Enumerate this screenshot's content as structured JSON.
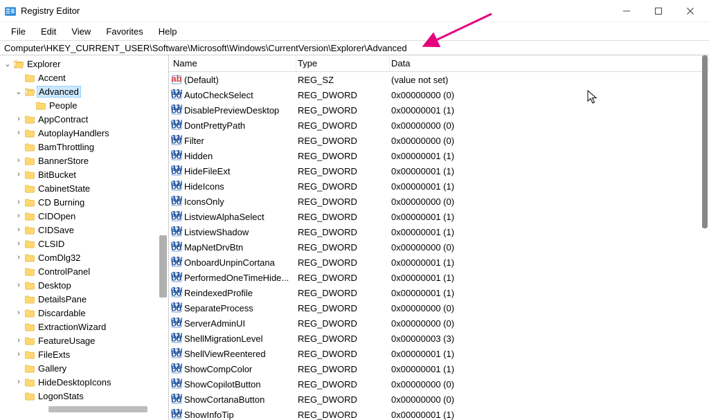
{
  "window": {
    "title": "Registry Editor"
  },
  "menubar": {
    "file": "File",
    "edit": "Edit",
    "view": "View",
    "favorites": "Favorites",
    "help": "Help"
  },
  "address": {
    "path": "Computer\\HKEY_CURRENT_USER\\Software\\Microsoft\\Windows\\CurrentVersion\\Explorer\\Advanced"
  },
  "columns": {
    "name": "Name",
    "type": "Type",
    "data": "Data"
  },
  "tree": {
    "root": {
      "label": "Explorer",
      "expanded": true,
      "depth": 0
    },
    "children": [
      {
        "label": "Accent",
        "depth": 1,
        "hasChildren": false
      },
      {
        "label": "Advanced",
        "depth": 1,
        "hasChildren": true,
        "expanded": true,
        "selected": true
      },
      {
        "label": "People",
        "depth": 2,
        "hasChildren": false
      },
      {
        "label": "AppContract",
        "depth": 1,
        "hasChildren": true
      },
      {
        "label": "AutoplayHandlers",
        "depth": 1,
        "hasChildren": true
      },
      {
        "label": "BamThrottling",
        "depth": 1,
        "hasChildren": false
      },
      {
        "label": "BannerStore",
        "depth": 1,
        "hasChildren": true
      },
      {
        "label": "BitBucket",
        "depth": 1,
        "hasChildren": true
      },
      {
        "label": "CabinetState",
        "depth": 1,
        "hasChildren": false
      },
      {
        "label": "CD Burning",
        "depth": 1,
        "hasChildren": true
      },
      {
        "label": "CIDOpen",
        "depth": 1,
        "hasChildren": true
      },
      {
        "label": "CIDSave",
        "depth": 1,
        "hasChildren": true
      },
      {
        "label": "CLSID",
        "depth": 1,
        "hasChildren": true
      },
      {
        "label": "ComDlg32",
        "depth": 1,
        "hasChildren": true
      },
      {
        "label": "ControlPanel",
        "depth": 1,
        "hasChildren": false
      },
      {
        "label": "Desktop",
        "depth": 1,
        "hasChildren": true
      },
      {
        "label": "DetailsPane",
        "depth": 1,
        "hasChildren": false
      },
      {
        "label": "Discardable",
        "depth": 1,
        "hasChildren": true
      },
      {
        "label": "ExtractionWizard",
        "depth": 1,
        "hasChildren": false
      },
      {
        "label": "FeatureUsage",
        "depth": 1,
        "hasChildren": true
      },
      {
        "label": "FileExts",
        "depth": 1,
        "hasChildren": true
      },
      {
        "label": "Gallery",
        "depth": 1,
        "hasChildren": false
      },
      {
        "label": "HideDesktopIcons",
        "depth": 1,
        "hasChildren": true
      },
      {
        "label": "LogonStats",
        "depth": 1,
        "hasChildren": false
      }
    ]
  },
  "values": [
    {
      "name": "(Default)",
      "type": "REG_SZ",
      "data": "(value not set)",
      "iconType": "sz"
    },
    {
      "name": "AutoCheckSelect",
      "type": "REG_DWORD",
      "data": "0x00000000 (0)",
      "iconType": "dw"
    },
    {
      "name": "DisablePreviewDesktop",
      "type": "REG_DWORD",
      "data": "0x00000001 (1)",
      "iconType": "dw"
    },
    {
      "name": "DontPrettyPath",
      "type": "REG_DWORD",
      "data": "0x00000000 (0)",
      "iconType": "dw"
    },
    {
      "name": "Filter",
      "type": "REG_DWORD",
      "data": "0x00000000 (0)",
      "iconType": "dw"
    },
    {
      "name": "Hidden",
      "type": "REG_DWORD",
      "data": "0x00000001 (1)",
      "iconType": "dw"
    },
    {
      "name": "HideFileExt",
      "type": "REG_DWORD",
      "data": "0x00000001 (1)",
      "iconType": "dw"
    },
    {
      "name": "HideIcons",
      "type": "REG_DWORD",
      "data": "0x00000001 (1)",
      "iconType": "dw"
    },
    {
      "name": "IconsOnly",
      "type": "REG_DWORD",
      "data": "0x00000000 (0)",
      "iconType": "dw"
    },
    {
      "name": "ListviewAlphaSelect",
      "type": "REG_DWORD",
      "data": "0x00000001 (1)",
      "iconType": "dw"
    },
    {
      "name": "ListviewShadow",
      "type": "REG_DWORD",
      "data": "0x00000001 (1)",
      "iconType": "dw"
    },
    {
      "name": "MapNetDrvBtn",
      "type": "REG_DWORD",
      "data": "0x00000000 (0)",
      "iconType": "dw"
    },
    {
      "name": "OnboardUnpinCortana",
      "type": "REG_DWORD",
      "data": "0x00000001 (1)",
      "iconType": "dw"
    },
    {
      "name": "PerformedOneTimeHide...",
      "type": "REG_DWORD",
      "data": "0x00000001 (1)",
      "iconType": "dw"
    },
    {
      "name": "ReindexedProfile",
      "type": "REG_DWORD",
      "data": "0x00000001 (1)",
      "iconType": "dw"
    },
    {
      "name": "SeparateProcess",
      "type": "REG_DWORD",
      "data": "0x00000000 (0)",
      "iconType": "dw"
    },
    {
      "name": "ServerAdminUI",
      "type": "REG_DWORD",
      "data": "0x00000000 (0)",
      "iconType": "dw"
    },
    {
      "name": "ShellMigrationLevel",
      "type": "REG_DWORD",
      "data": "0x00000003 (3)",
      "iconType": "dw"
    },
    {
      "name": "ShellViewReentered",
      "type": "REG_DWORD",
      "data": "0x00000001 (1)",
      "iconType": "dw"
    },
    {
      "name": "ShowCompColor",
      "type": "REG_DWORD",
      "data": "0x00000001 (1)",
      "iconType": "dw"
    },
    {
      "name": "ShowCopilotButton",
      "type": "REG_DWORD",
      "data": "0x00000000 (0)",
      "iconType": "dw"
    },
    {
      "name": "ShowCortanaButton",
      "type": "REG_DWORD",
      "data": "0x00000000 (0)",
      "iconType": "dw"
    },
    {
      "name": "ShowInfoTip",
      "type": "REG_DWORD",
      "data": "0x00000001 (1)",
      "iconType": "dw"
    }
  ]
}
